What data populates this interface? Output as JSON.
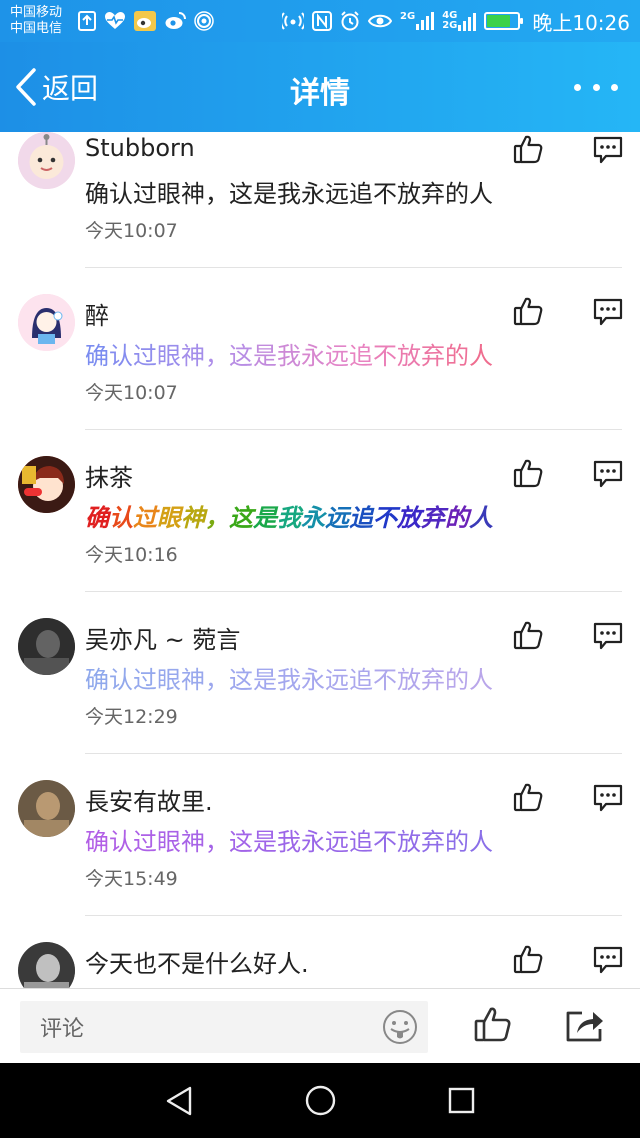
{
  "status_bar": {
    "carrier_1": "中国移动",
    "carrier_2": "中国电信",
    "signal_1": "2G",
    "signal_2": "4G",
    "signal_3": "2G",
    "battery_level": 0.75,
    "time": "晚上10:26",
    "icons_left": [
      "upload-icon",
      "heart-monitor-icon",
      "weibo-icon",
      "weibo-icon",
      "hotspot-icon"
    ],
    "icons_right": [
      "wireless-icon",
      "nfc-icon",
      "alarm-icon",
      "eye-icon",
      "signal-icon",
      "signal-icon",
      "battery-icon"
    ]
  },
  "header": {
    "back_label": "返回",
    "title": "详情",
    "more_icon": "more-icon"
  },
  "comments": [
    {
      "username": "Stubborn",
      "text": "确认过眼神，这是我永远追不放弃的人",
      "time": "今天10:07",
      "style": "plain",
      "color": "#222222",
      "avatar_icon": "teletubby-avatar-icon"
    },
    {
      "username": "醉",
      "text": "确认过眼神，这是我永远追不放弃的人",
      "time": "今天10:07",
      "style": "gradient",
      "gradient": [
        "#7b8cf0",
        "#b18ee8",
        "#e884c4",
        "#ef6d8f"
      ],
      "avatar_icon": "anime-girl-avatar-icon"
    },
    {
      "username": "抹茶",
      "text": "确认过眼神，这是我永远追不放弃的人",
      "time": "今天10:16",
      "style": "rainbow",
      "rainbow": [
        "#e02020",
        "#e84a1a",
        "#e8861a",
        "#d4a015",
        "#b8a710",
        "#7aaa12",
        "#3aa818",
        "#1aa84a",
        "#17a880",
        "#1590a8",
        "#1570b8",
        "#1a50c0",
        "#2038c8",
        "#3a28c8",
        "#5028c0",
        "#6a22b8",
        "#3a3ab8"
      ],
      "avatar_icon": "cartoon-avatar-icon"
    },
    {
      "username": "吴亦凡 ~ 菀言",
      "text": "确认过眼神，这是我永远追不放弃的人",
      "time": "今天12:29",
      "style": "gradient",
      "gradient": [
        "#8fa8ec",
        "#a3a7ee",
        "#b9a6ea"
      ],
      "avatar_icon": "photo-avatar-icon"
    },
    {
      "username": "長安有故里.",
      "text": "确认过眼神，这是我永远追不放弃的人",
      "time": "今天15:49",
      "style": "gradient",
      "gradient": [
        "#b25fe6",
        "#9c66e8",
        "#8a6fe8"
      ],
      "avatar_icon": "photo-avatar-icon"
    },
    {
      "username": "今天也不是什么好人.",
      "text": "",
      "time": "",
      "style": "plain",
      "color": "#222222",
      "avatar_icon": "photo-avatar-icon"
    }
  ],
  "bottom_bar": {
    "comment_placeholder": "评论",
    "emoji_icon": "emoji-icon",
    "like_icon": "thumbs-up-icon",
    "share_icon": "share-icon"
  },
  "nav_bar": {
    "back_icon": "nav-back-icon",
    "home_icon": "nav-home-icon",
    "recent_icon": "nav-recent-icon"
  },
  "colors": {
    "header_start": "#1d8fe6",
    "header_end": "#25b6f6",
    "time_text": "#666666",
    "divider": "#e3e3e3"
  }
}
